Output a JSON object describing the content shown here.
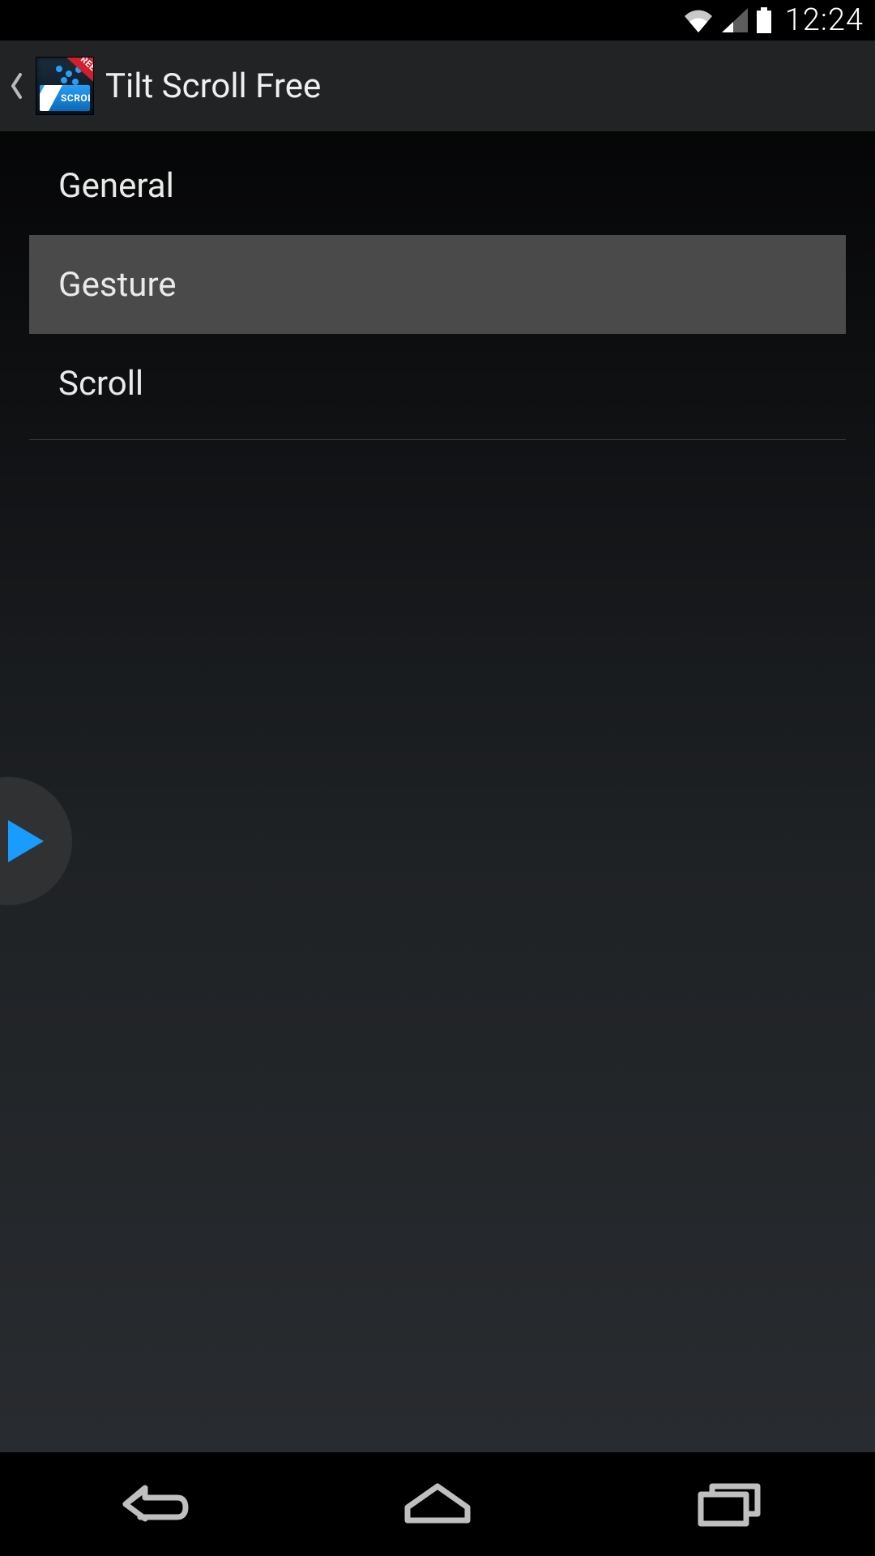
{
  "status_bar": {
    "time": "12:24"
  },
  "action_bar": {
    "title": "Tilt Scroll Free",
    "icon_ribbon_text": "FREE",
    "icon_plate_text": "SCROLL"
  },
  "settings": {
    "items": [
      {
        "label": "General",
        "selected": false
      },
      {
        "label": "Gesture",
        "selected": true
      },
      {
        "label": "Scroll",
        "selected": false
      }
    ]
  }
}
